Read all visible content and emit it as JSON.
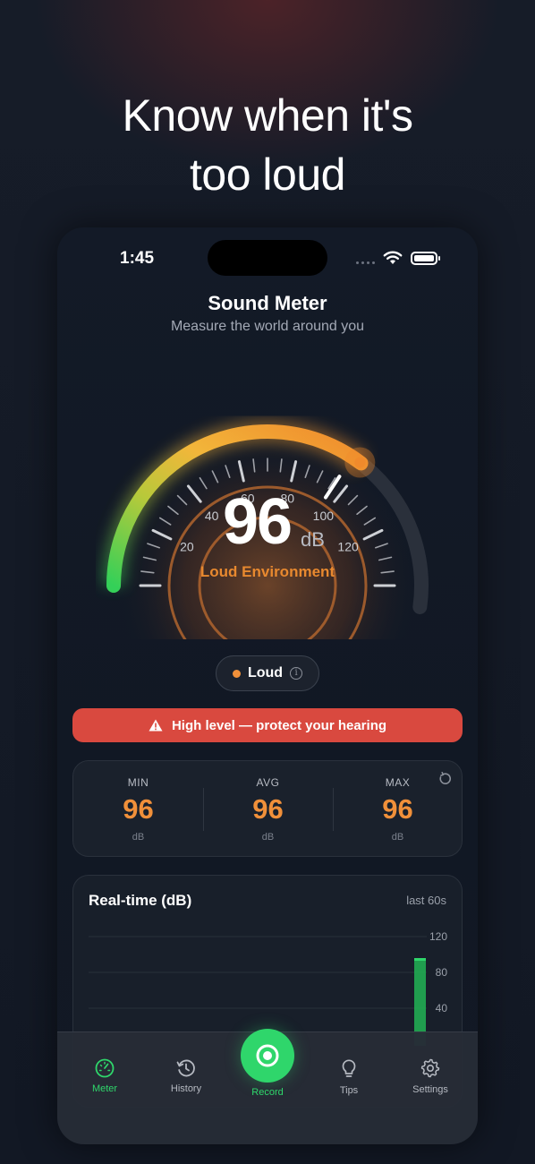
{
  "headline": "Know when it's too loud",
  "status_bar": {
    "time": "1:45"
  },
  "header": {
    "title": "Sound Meter",
    "subtitle": "Measure the world around you"
  },
  "meter": {
    "value": "96",
    "unit": "dB",
    "environment": "Loud Environment",
    "scale_labels": [
      "20",
      "40",
      "60",
      "80",
      "100",
      "120"
    ],
    "scale_min": 0,
    "scale_max": 140,
    "reading": 96
  },
  "level_pill": {
    "label": "Loud",
    "dot_color": "#f0903a"
  },
  "alert": {
    "text": "High level — protect your hearing",
    "color": "#d9493f"
  },
  "stats": {
    "min": {
      "label": "MIN",
      "value": "96",
      "unit": "dB"
    },
    "avg": {
      "label": "AVG",
      "value": "96",
      "unit": "dB"
    },
    "max": {
      "label": "MAX",
      "value": "96",
      "unit": "dB"
    }
  },
  "chart": {
    "title": "Real-time (dB)",
    "range": "last 60s",
    "y_ticks": [
      "120",
      "80",
      "40"
    ],
    "latest_value": 96
  },
  "tabs": [
    {
      "label": "Meter",
      "icon": "gauge-icon",
      "active": true
    },
    {
      "label": "History",
      "icon": "history-icon",
      "active": false
    },
    {
      "label": "Record",
      "icon": "record-icon",
      "active": false
    },
    {
      "label": "Tips",
      "icon": "lightbulb-icon",
      "active": false
    },
    {
      "label": "Settings",
      "icon": "gear-icon",
      "active": false
    }
  ],
  "colors": {
    "accent": "#2fd66b",
    "warning": "#f0903a",
    "danger": "#d9493f"
  }
}
